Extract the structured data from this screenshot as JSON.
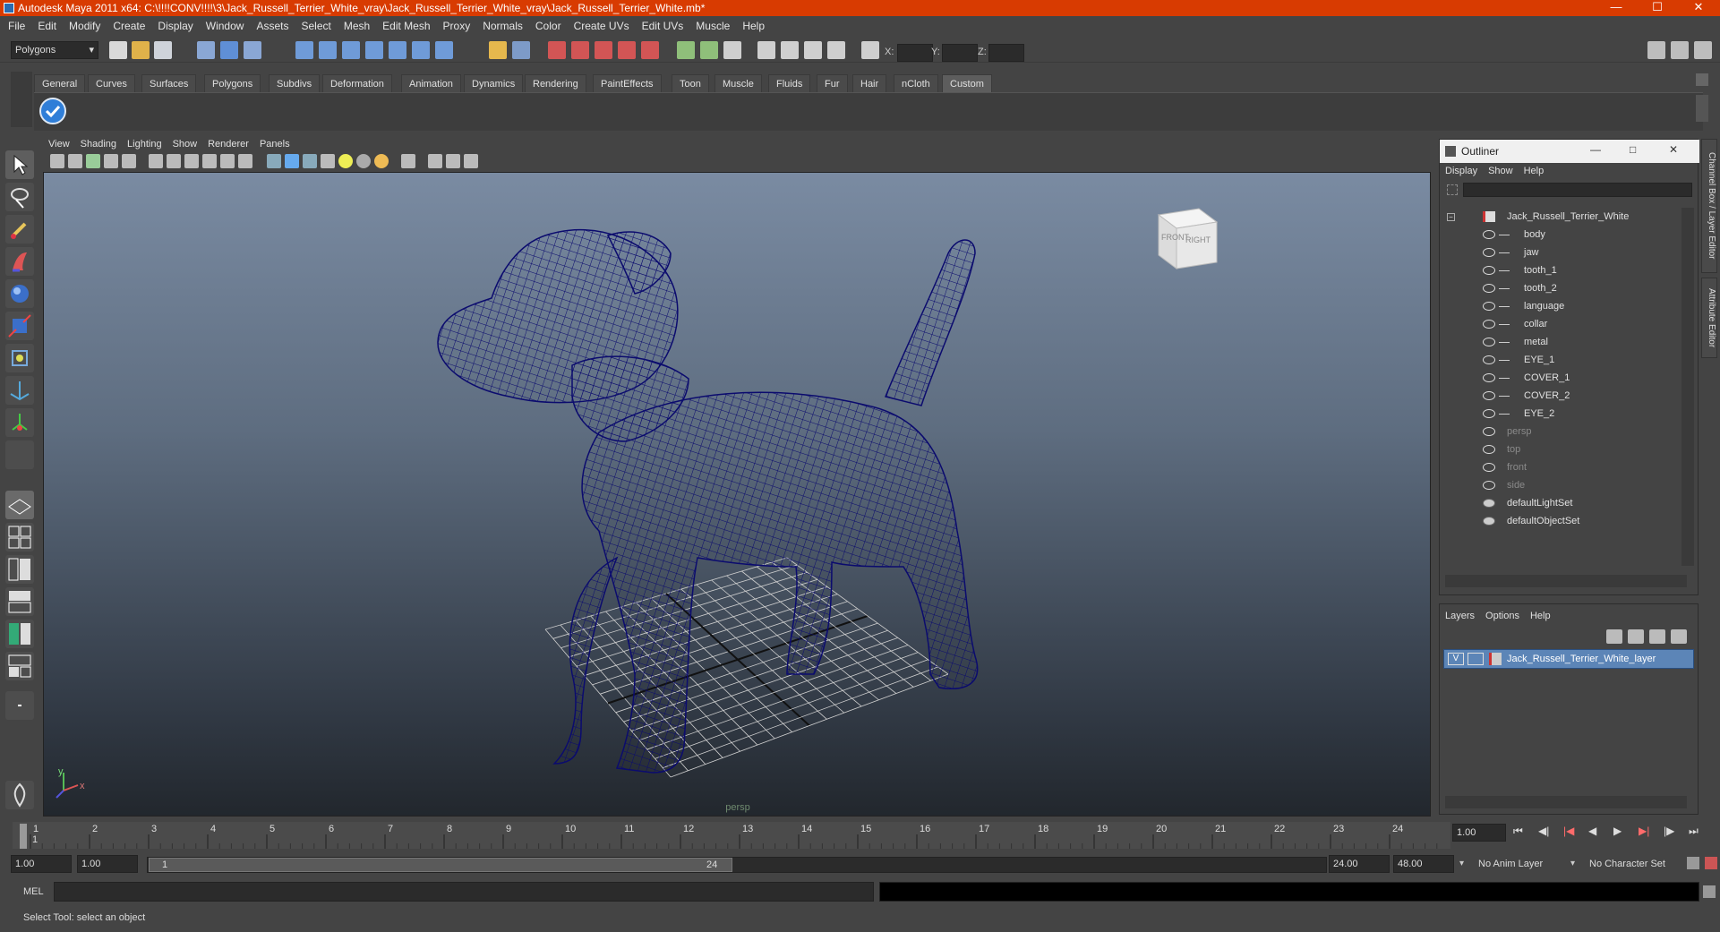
{
  "window": {
    "title": "Autodesk Maya 2011 x64: C:\\!!!!CONV!!!!\\3\\Jack_Russell_Terrier_White_vray\\Jack_Russell_Terrier_White_vray\\Jack_Russell_Terrier_White.mb*",
    "controls": {
      "minimize": "—",
      "maximize": "☐",
      "close": "✕"
    }
  },
  "menubar": {
    "items": [
      "File",
      "Edit",
      "Modify",
      "Create",
      "Display",
      "Window",
      "Assets",
      "Select",
      "Mesh",
      "Edit Mesh",
      "Proxy",
      "Normals",
      "Color",
      "Create UVs",
      "Edit UVs",
      "Muscle",
      "Help"
    ]
  },
  "statusline": {
    "mode": "Polygons",
    "coords": {
      "x_label": "X:",
      "y_label": "Y:",
      "z_label": "Z:"
    }
  },
  "shelf": {
    "tabs": [
      "General",
      "Curves",
      "Surfaces",
      "Polygons",
      "Subdivs",
      "Deformation",
      "Animation",
      "Dynamics",
      "Rendering",
      "PaintEffects",
      "Toon",
      "Muscle",
      "Fluids",
      "Fur",
      "Hair",
      "nCloth",
      "Custom"
    ],
    "active_tab": "Custom"
  },
  "viewport": {
    "menu": [
      "View",
      "Shading",
      "Lighting",
      "Show",
      "Renderer",
      "Panels"
    ],
    "camera_label": "persp",
    "viewcube": {
      "front": "FRONT",
      "right": "RIGHT"
    },
    "axis": {
      "y": "y",
      "x": "x"
    },
    "colors": {
      "wireframe": "#0b0b6e",
      "grid": "#cfcfcf"
    }
  },
  "outliner": {
    "title": "Outliner",
    "menu": [
      "Display",
      "Show",
      "Help"
    ],
    "root": "Jack_Russell_Terrier_White",
    "children": [
      "body",
      "jaw",
      "tooth_1",
      "tooth_2",
      "language",
      "collar",
      "metal",
      "EYE_1",
      "COVER_1",
      "COVER_2",
      "EYE_2"
    ],
    "cameras": [
      "persp",
      "top",
      "front",
      "side"
    ],
    "sets": [
      "defaultLightSet",
      "defaultObjectSet"
    ]
  },
  "layers": {
    "menu": [
      "Layers",
      "Options",
      "Help"
    ],
    "rows": [
      {
        "visible": "V",
        "name": "Jack_Russell_Terrier_White_layer"
      }
    ]
  },
  "side_tabs": [
    "Channel Box / Layer Editor",
    "Attribute Editor"
  ],
  "timeline": {
    "ticks": [
      "1",
      "2",
      "3",
      "4",
      "5",
      "6",
      "7",
      "8",
      "9",
      "10",
      "11",
      "12",
      "13",
      "14",
      "15",
      "16",
      "17",
      "18",
      "19",
      "20",
      "21",
      "22",
      "23",
      "24"
    ],
    "current_frame_marker": "1",
    "current_time": "1.00"
  },
  "range": {
    "start": "1.00",
    "playback_start": "1.00",
    "slider_start": "1",
    "slider_end": "24",
    "playback_end": "24.00",
    "end": "48.00",
    "anim_layer": "No Anim Layer",
    "character_set": "No Character Set"
  },
  "commandline": {
    "label": "MEL"
  },
  "helpline": {
    "text": "Select Tool: select an object"
  }
}
